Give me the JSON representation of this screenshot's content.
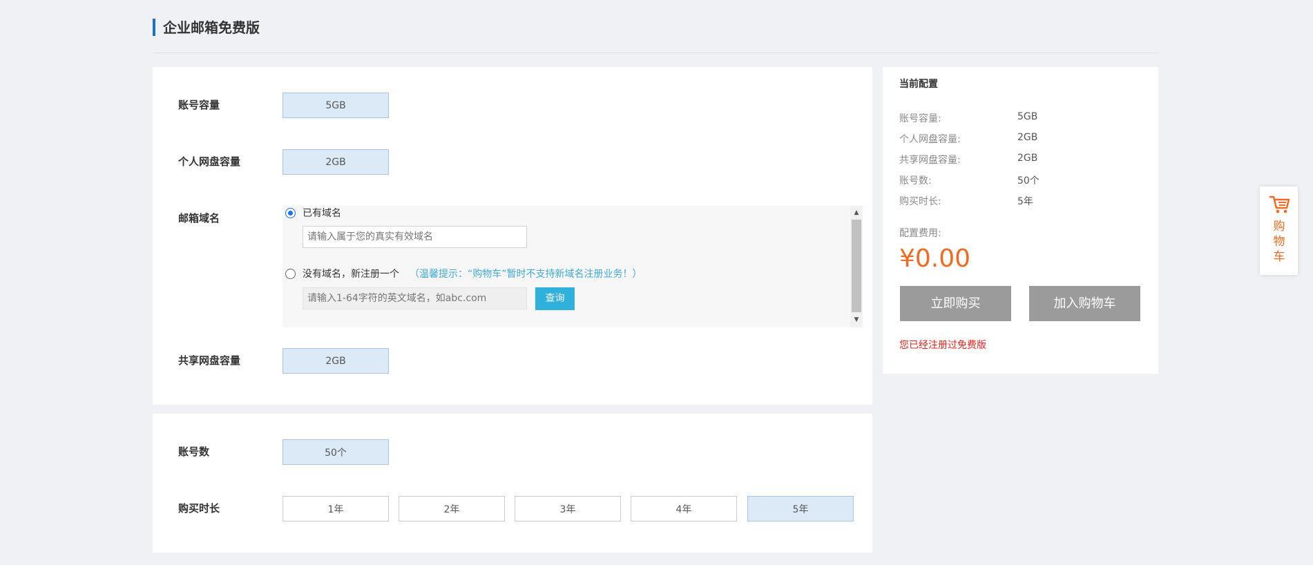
{
  "page": {
    "title": "企业邮箱免费版"
  },
  "config": {
    "account_capacity": {
      "label": "账号容量",
      "value": "5GB"
    },
    "personal_disk": {
      "label": "个人网盘容量",
      "value": "2GB"
    },
    "mail_domain": {
      "label": "邮箱域名",
      "has_domain": {
        "label": "已有域名",
        "checked": true,
        "placeholder": "请输入属于您的真实有效域名"
      },
      "no_domain": {
        "label": "没有域名，新注册一个",
        "hint": "（温馨提示：“购物车”暂时不支持新域名注册业务！）",
        "placeholder": "请输入1-64字符的英文域名，如abc.com",
        "query_button": "查询"
      }
    },
    "shared_disk": {
      "label": "共享网盘容量",
      "value": "2GB"
    },
    "account_count": {
      "label": "账号数",
      "value": "50个"
    },
    "duration": {
      "label": "购买时长",
      "options": [
        "1年",
        "2年",
        "3年",
        "4年",
        "5年"
      ],
      "selected": "5年"
    }
  },
  "summary": {
    "title": "当前配置",
    "items": [
      {
        "label": "账号容量:",
        "value": "5GB"
      },
      {
        "label": "个人网盘容量:",
        "value": "2GB"
      },
      {
        "label": "共享网盘容量:",
        "value": "2GB"
      },
      {
        "label": "账号数:",
        "value": "50个"
      },
      {
        "label": "购买时长:",
        "value": "5年"
      }
    ],
    "fee_label": "配置费用:",
    "price": "¥0.00",
    "buy_button": "立即购买",
    "add_cart_button": "加入购物车",
    "notice": "您已经注册过免费版"
  },
  "floating_cart": {
    "icon": "cart-icon",
    "label": "购物车"
  },
  "colors": {
    "accent": "#1a73c8",
    "price": "#f26a21",
    "selected_bg": "#dbeaf6",
    "notice": "#e8221b",
    "query": "#2fb1dc"
  }
}
